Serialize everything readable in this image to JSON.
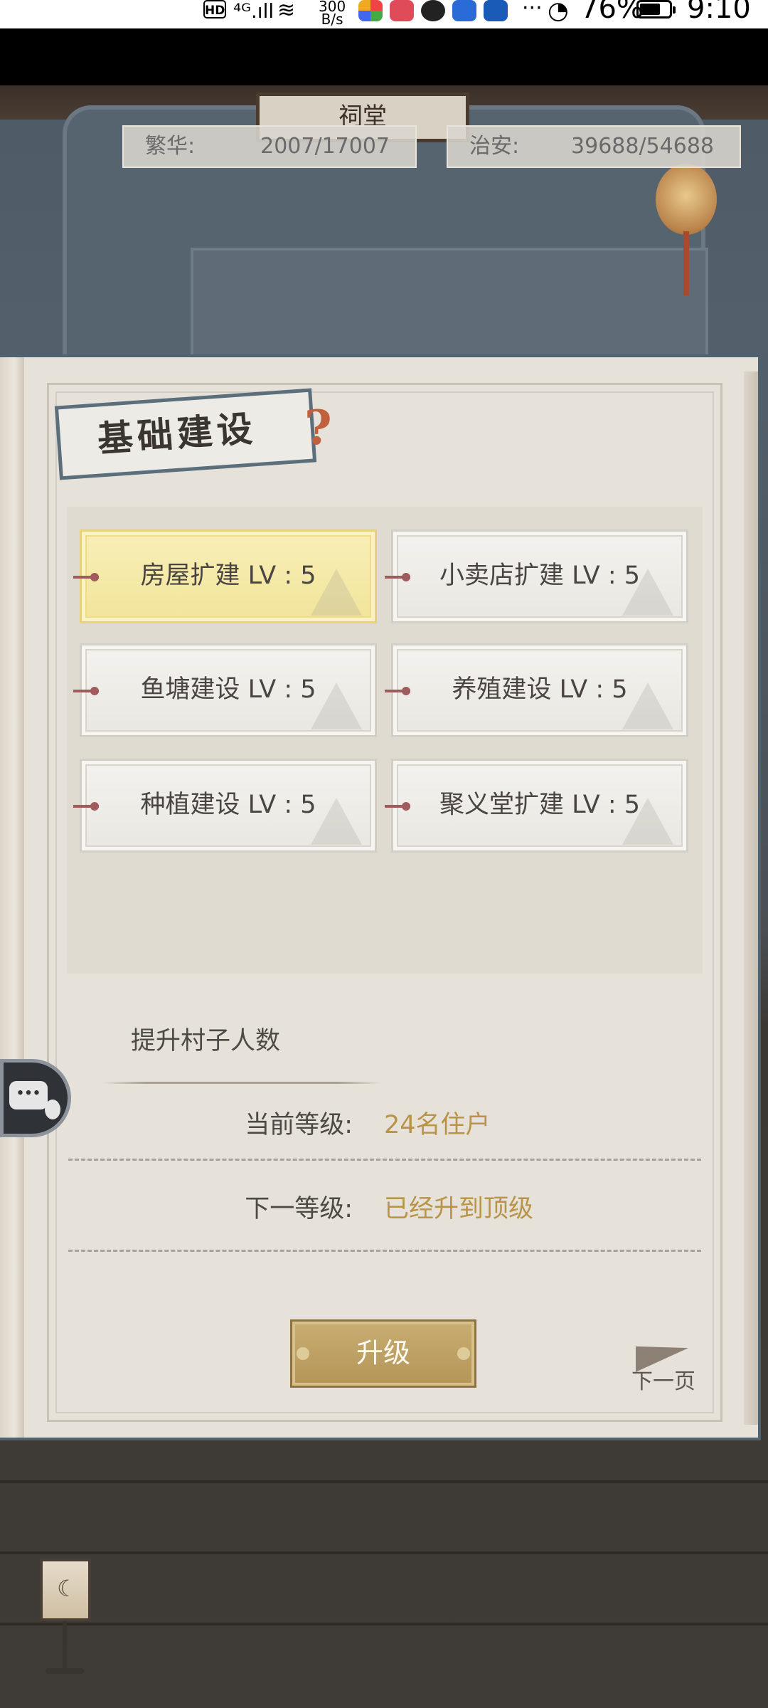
{
  "status_bar": {
    "hd": "HD",
    "signal": "⁴ᴳ.ıll",
    "wifi": "≋",
    "speed_value": "300",
    "speed_unit": "B/s",
    "more": "···",
    "battery_percent": "76%",
    "time": "9:10"
  },
  "scene": {
    "plaque_text": "祠堂"
  },
  "stats": {
    "prosperity": {
      "label": "繁华:",
      "value": "2007/17007"
    },
    "security": {
      "label": "治安:",
      "value": "39688/54688"
    }
  },
  "panel": {
    "title": "基础建设",
    "help_glyph": "?",
    "buildings": [
      {
        "label": "房屋扩建 LV : 5",
        "selected": true
      },
      {
        "label": "小卖店扩建 LV : 5",
        "selected": false
      },
      {
        "label": "鱼塘建设 LV : 5",
        "selected": false
      },
      {
        "label": "养殖建设 LV : 5",
        "selected": false
      },
      {
        "label": "种植建设 LV : 5",
        "selected": false
      },
      {
        "label": "聚义堂扩建 LV : 5",
        "selected": false
      }
    ],
    "detail": {
      "title": "提升村子人数",
      "current_label": "当前等级:",
      "current_value": "24名住户",
      "next_label": "下一等级:",
      "next_value": "已经升到顶级"
    },
    "upgrade_button": "升级",
    "next_page": "下一页"
  },
  "chat_button": {
    "icon": "chat-bubble-icon"
  },
  "colors": {
    "accent_gold": "#b99448",
    "button_gold": "#b49557",
    "selected_card": "#f2e49a",
    "frame_blue": "#4f6270"
  }
}
